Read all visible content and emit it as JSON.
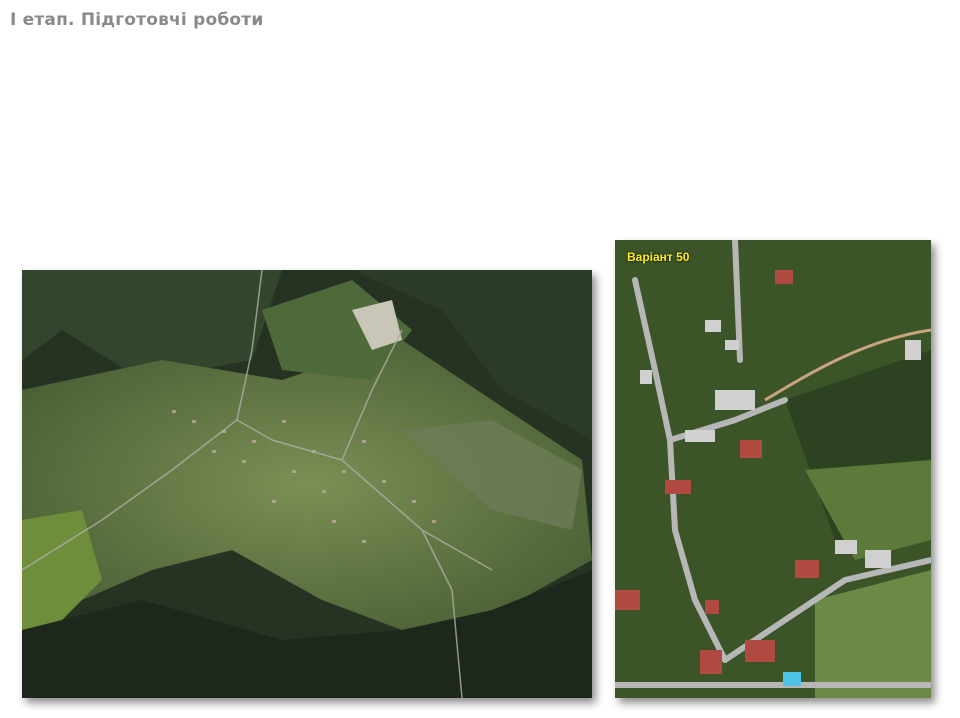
{
  "title": "І етап. Підготовчі роботи",
  "photos": {
    "left": {
      "name": "aerial-village-overview"
    },
    "right": {
      "name": "aerial-village-detail",
      "label": "Варіант 50"
    }
  },
  "colors": {
    "title": "#8a8a8a",
    "label": "#ffee22",
    "forest_dark": "#1f2a1c",
    "meadow": "#5c7a3a",
    "road": "#a9a9a9"
  }
}
